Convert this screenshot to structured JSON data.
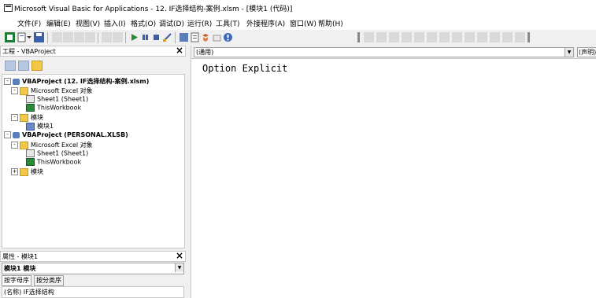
{
  "window": {
    "title": "Microsoft Visual Basic for Applications - 12. IF选择结构-案例.xlsm - [模块1 (代码)]"
  },
  "menu": {
    "items": [
      "文件(F)",
      "编辑(E)",
      "视图(V)",
      "插入(I)",
      "格式(O)",
      "调试(D)",
      "运行(R)",
      "工具(T)",
      "外接程序(A)",
      "窗口(W)",
      "帮助(H)"
    ]
  },
  "project_panel": {
    "title": "工程 - VBAProject",
    "tree": [
      {
        "level": 0,
        "toggle": "-",
        "icon": "project",
        "label": "VBAProject (12. IF选择结构-案例.xlsm)",
        "bold": true
      },
      {
        "level": 1,
        "toggle": "-",
        "icon": "folder",
        "label": "Microsoft Excel 对象"
      },
      {
        "level": 2,
        "toggle": "",
        "icon": "sheet",
        "label": "Sheet1 (Sheet1)"
      },
      {
        "level": 2,
        "toggle": "",
        "icon": "workbook",
        "label": "ThisWorkbook"
      },
      {
        "level": 1,
        "toggle": "-",
        "icon": "folder",
        "label": "模块"
      },
      {
        "level": 2,
        "toggle": "",
        "icon": "module",
        "label": "模块1"
      },
      {
        "level": 0,
        "toggle": "-",
        "icon": "project",
        "label": "VBAProject (PERSONAL.XLSB)",
        "bold": true
      },
      {
        "level": 1,
        "toggle": "-",
        "icon": "folder",
        "label": "Microsoft Excel 对象"
      },
      {
        "level": 2,
        "toggle": "",
        "icon": "sheet",
        "label": "Sheet1 (Sheet1)"
      },
      {
        "level": 2,
        "toggle": "",
        "icon": "workbook",
        "label": "ThisWorkbook"
      },
      {
        "level": 1,
        "toggle": "+",
        "icon": "folder",
        "label": "模块"
      }
    ]
  },
  "properties_panel": {
    "title": "属性 - 模块1",
    "object_combo": "模块1 模块",
    "tabs": [
      "按字母序",
      "按分类序"
    ],
    "first_row": "(名称) IF选择结构"
  },
  "code_window": {
    "object_combo": "(通用)",
    "procedure_combo": "(声明)",
    "lines": [
      "Option Explicit"
    ]
  },
  "colors": {
    "toolbar_bg": "#f0f0f0",
    "code_bg": "#ffffff"
  }
}
